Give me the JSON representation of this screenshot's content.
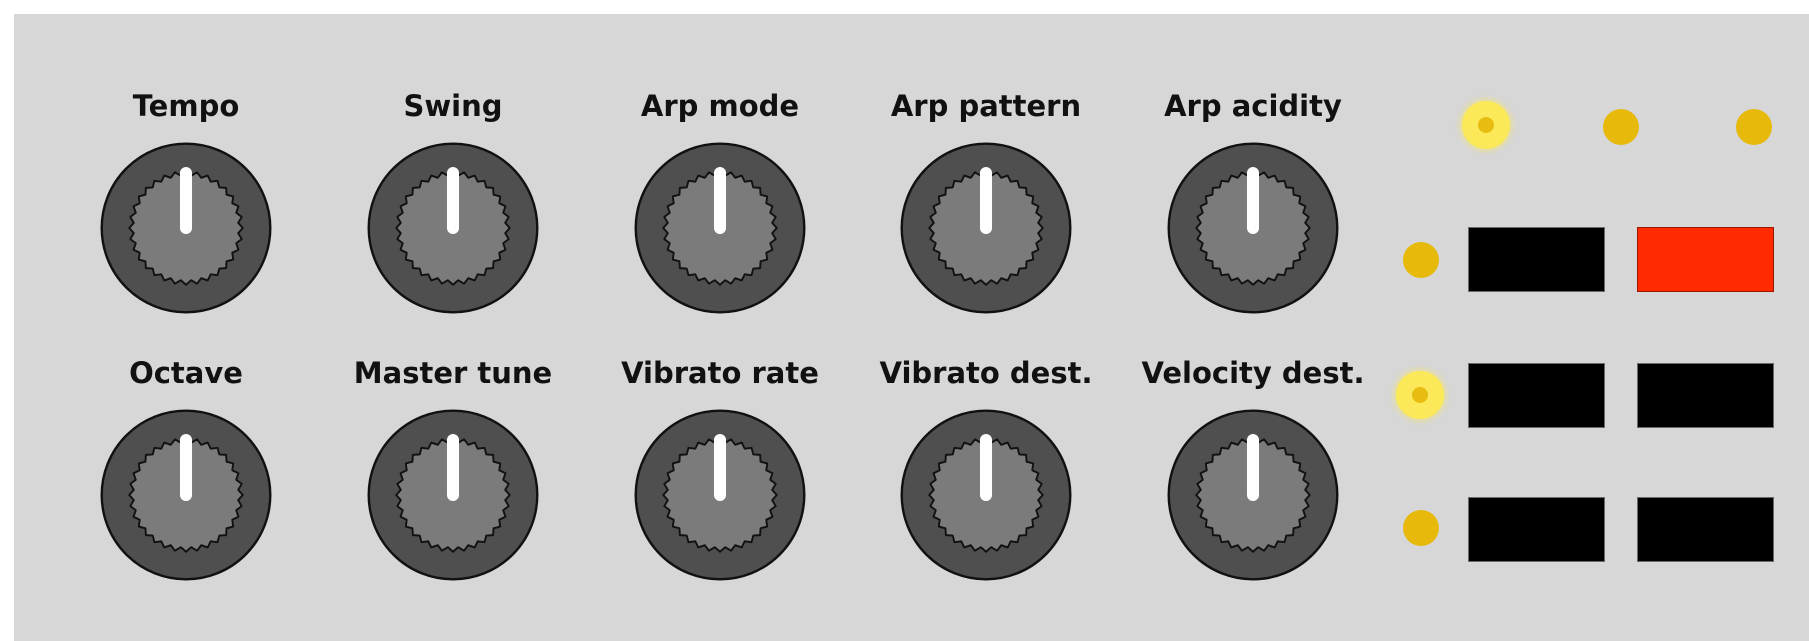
{
  "colors": {
    "panel": "#d7d7d7",
    "knob_body": "#4f4f4f",
    "knob_cap": "#7b7b7b",
    "indicator": "#ffffff",
    "led": "#e6b90a",
    "led_lit": "#fbe95a",
    "pad": "#000000",
    "pad_active": "#ff2a00"
  },
  "knobs": {
    "tempo": {
      "label": "Tempo",
      "icon": "knob-icon"
    },
    "swing": {
      "label": "Swing",
      "icon": "knob-icon"
    },
    "arp_mode": {
      "label": "Arp mode",
      "icon": "knob-icon"
    },
    "arp_pattern": {
      "label": "Arp pattern",
      "icon": "knob-icon"
    },
    "arp_acidity": {
      "label": "Arp acidity",
      "icon": "knob-icon"
    },
    "octave": {
      "label": "Octave",
      "icon": "knob-icon"
    },
    "master_tune": {
      "label": "Master tune",
      "icon": "knob-icon"
    },
    "vibrato_rate": {
      "label": "Vibrato rate",
      "icon": "knob-icon"
    },
    "vibrato_dest": {
      "label": "Vibrato dest.",
      "icon": "knob-icon"
    },
    "velocity_dest": {
      "label": "Velocity dest.",
      "icon": "knob-icon"
    }
  },
  "leds": {
    "top": [
      {
        "state": "on"
      },
      {
        "state": "off"
      },
      {
        "state": "off"
      }
    ],
    "left": [
      {
        "state": "off"
      },
      {
        "state": "on"
      },
      {
        "state": "off"
      }
    ]
  },
  "pads": [
    {
      "row": 1,
      "col": 1,
      "state": "off"
    },
    {
      "row": 1,
      "col": 2,
      "state": "active"
    },
    {
      "row": 2,
      "col": 1,
      "state": "off"
    },
    {
      "row": 2,
      "col": 2,
      "state": "off"
    },
    {
      "row": 3,
      "col": 1,
      "state": "off"
    },
    {
      "row": 3,
      "col": 2,
      "state": "off"
    }
  ]
}
